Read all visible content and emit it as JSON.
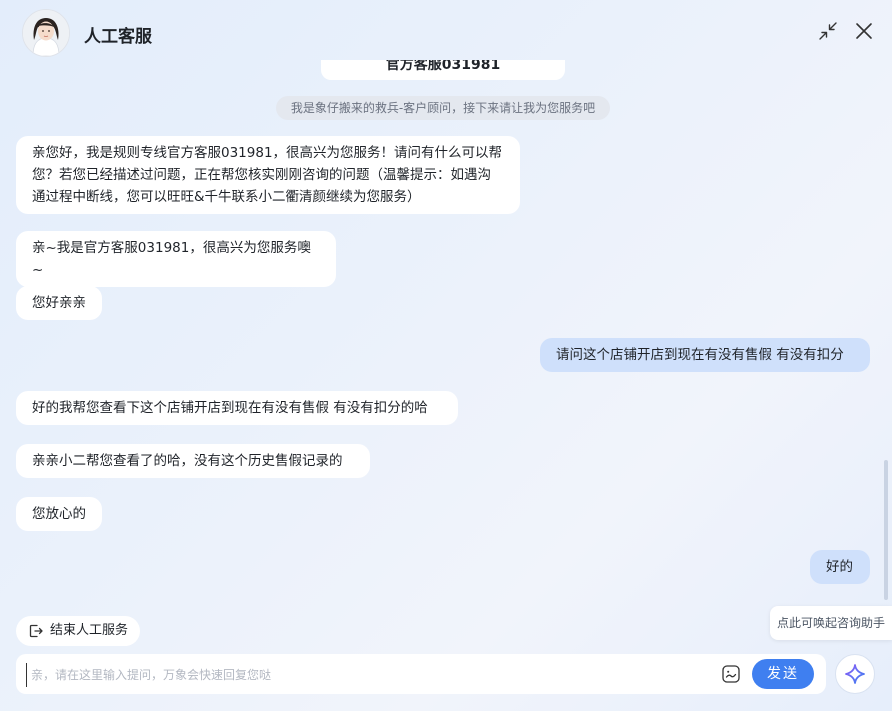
{
  "header": {
    "title": "人工客服"
  },
  "chat": {
    "partial_card_text": "官方客服031981",
    "system_notice": "我是象仔搬来的救兵-客户顾问，接下来请让我为您服务吧",
    "messages": [
      {
        "side": "left",
        "text": "亲您好，我是规则专线官方客服031981，很高兴为您服务！请问有什么可以帮您？若您已经描述过问题，正在帮您核实刚刚咨询的问题（温馨提示：如遇沟通过程中断线，您可以旺旺&千牛联系小二衢清颜继续为您服务）"
      },
      {
        "side": "left",
        "text": "亲~我是官方客服031981，很高兴为您服务噢~"
      },
      {
        "side": "left",
        "text": "您好亲亲"
      },
      {
        "side": "right",
        "text": "请问这个店铺开店到现在有没有售假 有没有扣分"
      },
      {
        "side": "left",
        "text": "好的我帮您查看下这个店铺开店到现在有没有售假 有没有扣分的哈"
      },
      {
        "side": "left",
        "text": "亲亲小二帮您查看了的哈，没有这个历史售假记录的"
      },
      {
        "side": "left",
        "text": "您放心的"
      },
      {
        "side": "right",
        "text": "好的"
      }
    ]
  },
  "actions": {
    "end_service_label": "结束人工服务"
  },
  "tooltip": {
    "text": "点此可唤起咨询助手"
  },
  "input": {
    "placeholder": "亲，请在这里输入提问，万象会快速回复您哒",
    "value": "",
    "send_label": "发送"
  },
  "icons": {
    "avatar": "agent-avatar",
    "minimize": "minimize-arrows-icon",
    "close": "close-icon",
    "end_service": "exit-icon",
    "emoji": "emoji-icon",
    "assistant": "sparkle-icon"
  },
  "colors": {
    "accent": "#3f7ff0",
    "user_bubble": "#cfe0fb",
    "agent_bubble": "#ffffff"
  }
}
